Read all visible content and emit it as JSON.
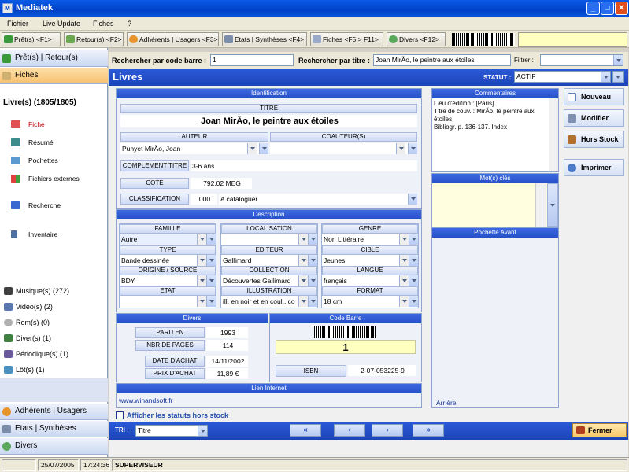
{
  "window": {
    "title": "Mediatek"
  },
  "menu": [
    "Fichier",
    "Live Update",
    "Fiches",
    "?"
  ],
  "toolbar": {
    "buttons": [
      "Prêt(s) <F1>",
      "Retour(s) <F2>",
      "Adhérents | Usagers <F3>",
      "Etats | Synthèses <F4>",
      "Fiches <F5 > F11>",
      "Divers <F12>"
    ]
  },
  "nav": {
    "top": [
      "Prêt(s) | Retour(s)",
      "Fiches"
    ],
    "section_title": "Livre(s) (1805/1805)",
    "sub": [
      "Fiche",
      "Résumé",
      "Pochettes",
      "Fichiers externes",
      "Recherche",
      "Inventaire"
    ],
    "categories": [
      "Musique(s) (272)",
      "Vidéo(s) (2)",
      "Rom(s) (0)",
      "Diver(s) (1)",
      "Périodique(s) (1)",
      "Lôt(s) (1)"
    ],
    "bottom": [
      "Adhérents | Usagers",
      "Etats | Synthèses",
      "Divers"
    ]
  },
  "search": {
    "barcode_label": "Rechercher par code barre :",
    "barcode_value": "1",
    "title_label": "Rechercher par titre :",
    "title_value": "Joan MirÃo, le peintre aux étoiles",
    "filter_label": "Filtrer :",
    "filter_value": ""
  },
  "header": {
    "title": "Livres",
    "statut_label": "STATUT :",
    "statut_value": "ACTIF"
  },
  "identification": {
    "header": "Identification",
    "titre_label": "TITRE",
    "titre_value": "Joan MirÃo, le peintre aux étoiles",
    "auteur_label": "AUTEUR",
    "auteur_value": "Punyet MirÃo, Joan",
    "coauteur_label": "COAUTEUR(S)",
    "coauteur_value": "",
    "complement_label": "COMPLEMENT TITRE",
    "complement_value": "3-6 ans",
    "cote_label": "COTE",
    "cote_value": "792.02 MEG",
    "classification_label": "CLASSIFICATION",
    "classification_code": "000",
    "classification_value": "A cataloguer"
  },
  "description": {
    "header": "Description",
    "famille_label": "FAMILLE",
    "famille_value": "Autre",
    "localisation_label": "LOCALISATION",
    "localisation_value": "",
    "genre_label": "GENRE",
    "genre_value": "Non Littéraire",
    "type_label": "TYPE",
    "type_value": "Bande dessinée",
    "editeur_label": "EDITEUR",
    "editeur_value": "Gallimard",
    "cible_label": "CIBLE",
    "cible_value": "Jeunes",
    "origine_label": "ORIGINE / SOURCE",
    "origine_value": "BDY",
    "collection_label": "COLLECTION",
    "collection_value": "Découvertes Gallimard",
    "langue_label": "LANGUE",
    "langue_value": "français",
    "etat_label": "ETAT",
    "etat_value": "",
    "illustration_label": "ILLUSTRATION",
    "illustration_value": "ill. en noir et en coul., co",
    "format_label": "FORMAT",
    "format_value": "18 cm"
  },
  "divers": {
    "header": "Divers",
    "paru_label": "PARU EN",
    "paru_value": "1993",
    "pages_label": "NBR DE PAGES",
    "pages_value": "114",
    "achat_label": "DATE D'ACHAT",
    "achat_value": "14/11/2002",
    "prix_label": "PRIX D'ACHAT",
    "prix_value": "11,89 €"
  },
  "codebarre": {
    "header": "Code Barre",
    "value": "1",
    "isbn_label": "ISBN",
    "isbn_value": "2-07-053225-9"
  },
  "lien": {
    "header": "Lien Internet",
    "value": "www.winandsoft.fr"
  },
  "commentaires": {
    "header": "Commentaires",
    "text": "Lieu d'édition : [Paris]\nTitre de couv. : MirÃo, le peintre aux étoiles\nBibliogr. p. 136-137. Index"
  },
  "motscles": {
    "header": "Mot(s) clés"
  },
  "pochette": {
    "header": "Pochette Avant",
    "arriere": "Arrière"
  },
  "actions": [
    "Nouveau",
    "Modifier",
    "Hors Stock",
    "Imprimer"
  ],
  "bottom": {
    "checkbox_label": "Afficher les statuts hors stock",
    "tri_label": "TRI :",
    "tri_value": "Titre",
    "nav": [
      "«",
      "‹",
      "›",
      "»"
    ],
    "fermer": "Fermer"
  },
  "status": {
    "date": "25/07/2005",
    "time": "17:24:36",
    "user": "SUPERVISEUR"
  }
}
